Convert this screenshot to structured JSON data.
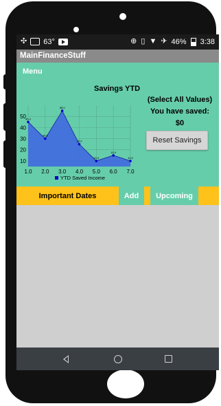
{
  "status_bar": {
    "temperature": "63°",
    "battery": "46%",
    "time": "3:38",
    "icons": [
      "fan-icon",
      "image-icon",
      "video-play-icon",
      "data-saver-icon",
      "vibrate-icon",
      "wifi-icon",
      "airplane-icon",
      "battery-icon"
    ]
  },
  "app": {
    "title": "MainFinanceStuff",
    "menu_label": "Menu"
  },
  "chart_data": {
    "type": "area",
    "title": "Savings YTD",
    "x": [
      1.0,
      2.0,
      3.0,
      4.0,
      5.0,
      6.0,
      7.0
    ],
    "xticks": [
      "1.0",
      "2.0",
      "3.0",
      "4.0",
      "5.0",
      "6.0",
      "7.0"
    ],
    "yticks": [
      "10",
      "20",
      "30",
      "40",
      "50"
    ],
    "ylim": [
      5,
      60
    ],
    "series": [
      {
        "name": "YTD Saved Income",
        "values": [
          45.0,
          30.0,
          55.0,
          25.0,
          10.0,
          15.0,
          10.0
        ],
        "point_labels": [
          "45.0",
          "30.0",
          "55.0",
          "25.0",
          "10.0",
          "15.0",
          "10.0"
        ]
      }
    ],
    "grid": true,
    "legend": "bottom",
    "colors": {
      "fill": "#4169e1",
      "line": "#1e3a9c",
      "point": "#0000c8"
    }
  },
  "savings_panel": {
    "select_all": "(Select All Values)",
    "saved_text": "You have saved:",
    "amount": "$0",
    "reset_label": "Reset Savings"
  },
  "tabs": {
    "important_dates": "Important Dates",
    "add": "Add",
    "upcoming": "Upcoming"
  },
  "colors": {
    "teal": "#66cdaa",
    "amber": "#ffc21a",
    "gray": "#cfcfcf"
  }
}
